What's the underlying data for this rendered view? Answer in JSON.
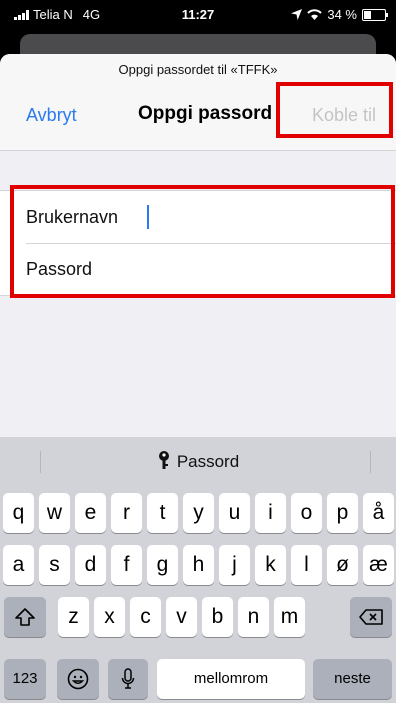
{
  "status_bar": {
    "carrier": "Telia N",
    "network": "4G",
    "time": "11:27",
    "battery": "34 %",
    "battery_level": 0.34
  },
  "sheet": {
    "prompt": "Oppgi passordet til «TFFK»",
    "cancel_label": "Avbryt",
    "title": "Oppgi passord",
    "connect_label": "Koble til"
  },
  "form": {
    "username_label": "Brukernavn",
    "password_label": "Passord"
  },
  "keyboard": {
    "suggestion": "Passord",
    "row1": [
      "q",
      "w",
      "e",
      "r",
      "t",
      "y",
      "u",
      "i",
      "o",
      "p",
      "å"
    ],
    "row2": [
      "a",
      "s",
      "d",
      "f",
      "g",
      "h",
      "j",
      "k",
      "l",
      "ø",
      "æ"
    ],
    "row3": [
      "z",
      "x",
      "c",
      "v",
      "b",
      "n",
      "m"
    ],
    "numbers_label": "123",
    "space_label": "mellomrom",
    "next_label": "neste"
  },
  "colors": {
    "accent": "#2b7bf0",
    "highlight": "#e00000",
    "disabled": "#c4c4c7"
  },
  "icons": [
    "signal-icon",
    "location-arrow-icon",
    "wifi-icon",
    "battery-icon",
    "key-icon",
    "shift-icon",
    "backspace-icon",
    "emoji-icon",
    "microphone-icon"
  ]
}
